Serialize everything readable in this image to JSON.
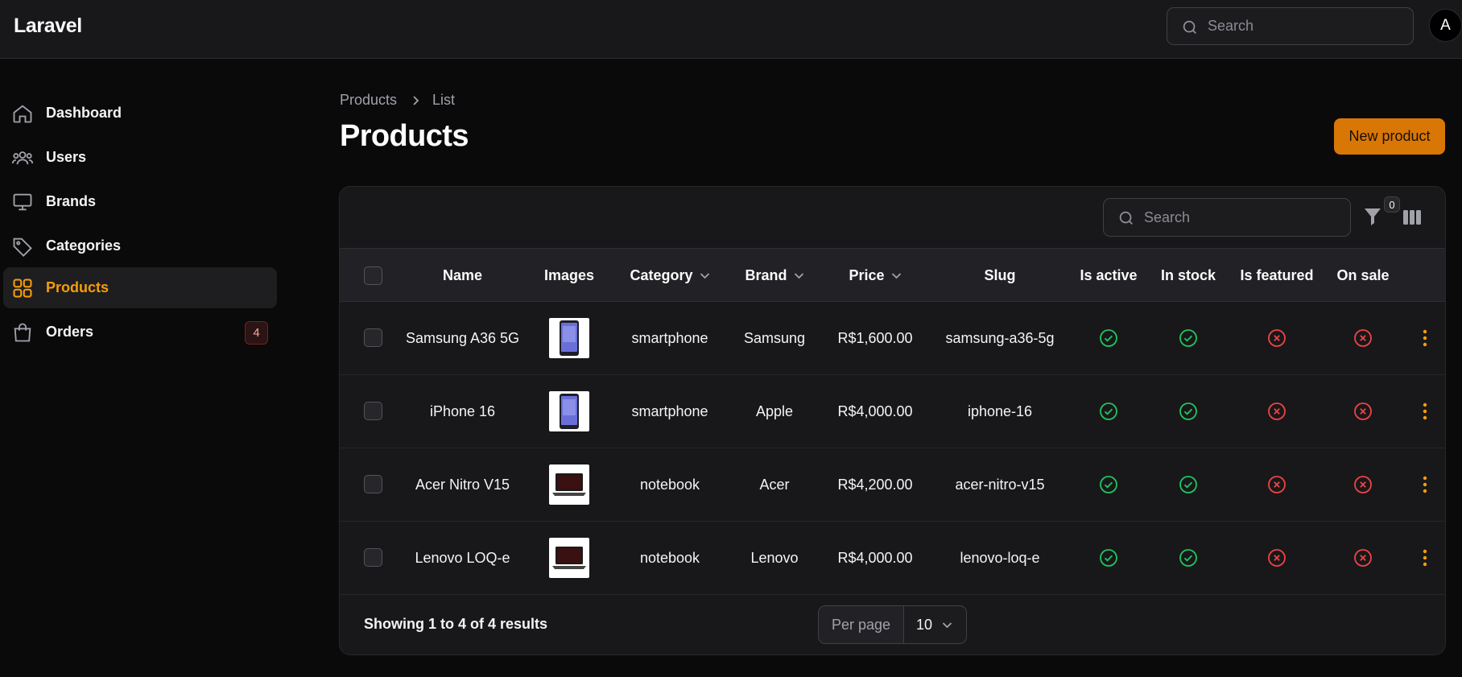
{
  "app": {
    "brand": "Laravel",
    "search_placeholder": "Search",
    "avatar_initial": "A"
  },
  "sidebar": {
    "items": [
      {
        "label": "Dashboard",
        "icon": "home-icon"
      },
      {
        "label": "Users",
        "icon": "users-icon"
      },
      {
        "label": "Brands",
        "icon": "monitor-icon"
      },
      {
        "label": "Categories",
        "icon": "tag-icon"
      },
      {
        "label": "Products",
        "icon": "grid-icon",
        "active": true
      },
      {
        "label": "Orders",
        "icon": "shopping-bag-icon",
        "badge": "4"
      }
    ]
  },
  "page": {
    "breadcrumb": [
      "Products",
      "List"
    ],
    "title": "Products",
    "new_button": "New product"
  },
  "table": {
    "search_placeholder": "Search",
    "filter_count": "0",
    "columns": [
      "Name",
      "Images",
      "Category",
      "Brand",
      "Price",
      "Slug",
      "Is active",
      "In stock",
      "Is featured",
      "On sale"
    ],
    "rows": [
      {
        "name": "Samsung A36 5G",
        "image": "phone-thumbnail",
        "category": "smartphone",
        "brand": "Samsung",
        "price": "R$1,600.00",
        "slug": "samsung-a36-5g",
        "is_active": true,
        "in_stock": true,
        "is_featured": false,
        "on_sale": false
      },
      {
        "name": "iPhone 16",
        "image": "phone-thumbnail",
        "category": "smartphone",
        "brand": "Apple",
        "price": "R$4,000.00",
        "slug": "iphone-16",
        "is_active": true,
        "in_stock": true,
        "is_featured": false,
        "on_sale": false
      },
      {
        "name": "Acer Nitro V15",
        "image": "laptop-thumbnail",
        "category": "notebook",
        "brand": "Acer",
        "price": "R$4,200.00",
        "slug": "acer-nitro-v15",
        "is_active": true,
        "in_stock": true,
        "is_featured": false,
        "on_sale": false
      },
      {
        "name": "Lenovo LOQ-e",
        "image": "laptop-thumbnail",
        "category": "notebook",
        "brand": "Lenovo",
        "price": "R$4,000.00",
        "slug": "lenovo-loq-e",
        "is_active": true,
        "in_stock": true,
        "is_featured": false,
        "on_sale": false
      }
    ],
    "footer": {
      "summary": "Showing 1 to 4 of 4 results",
      "per_page_label": "Per page",
      "per_page_value": "10"
    }
  },
  "colors": {
    "accent": "#f59e0b",
    "button": "#d97706",
    "success": "#22c55e",
    "danger": "#ef4444"
  }
}
